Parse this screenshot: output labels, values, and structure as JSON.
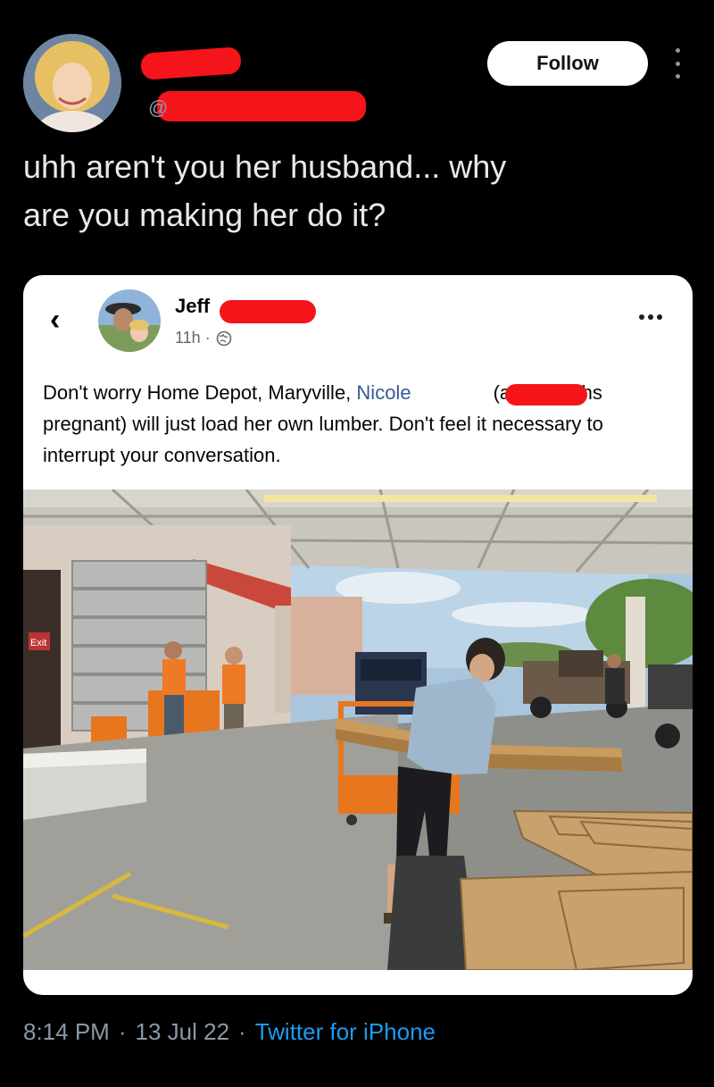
{
  "header": {
    "handle_prefix": "@",
    "follow_label": "Follow"
  },
  "icons": {
    "avatar": "profile-photo",
    "more": "more-vertical-icon",
    "back": "chevron-left-icon",
    "privacy": "globe-icon",
    "post_more": "more-horizontal-icon"
  },
  "tweet": {
    "line1": "uhh aren't you her husband... why",
    "line2": "are you making her do it?"
  },
  "embedded_post": {
    "author_name": "Jeff",
    "time": "11h ·",
    "text_part1": "Don't worry Home Depot, Maryville, ",
    "mention": "Nicole",
    "text_part2": "(at 8 months pregnant) will just load her own lumber. Don't feel it necessary to interrupt your conversation.",
    "photo_sign": "Exit"
  },
  "footer": {
    "time": "8:14 PM",
    "sep1": "·",
    "date": "13 Jul 22",
    "sep2": "·",
    "source": "Twitter for iPhone"
  },
  "colors": {
    "background": "#000000",
    "redaction": "#f4141a",
    "link": "#1d9bf0",
    "mention": "#385898"
  }
}
